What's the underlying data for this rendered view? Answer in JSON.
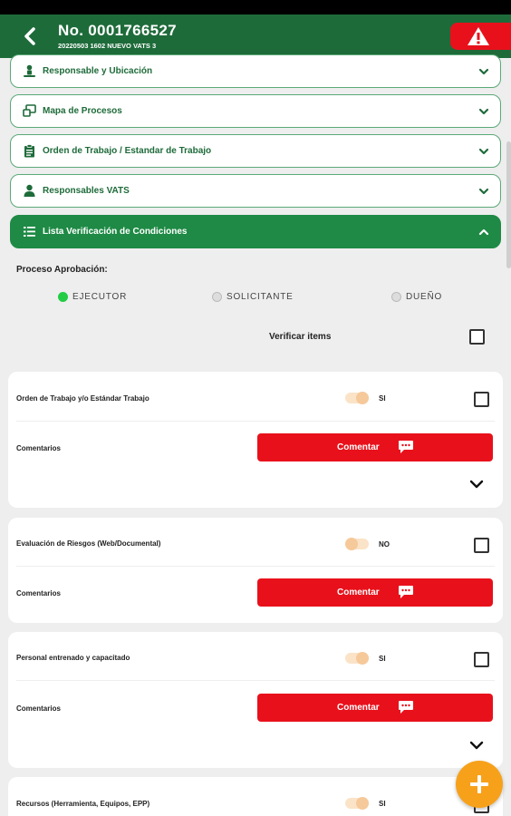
{
  "header": {
    "title": "No. 0001766527",
    "subtitle": "20220503 1602 NUEVO VATS 3"
  },
  "accordions": [
    {
      "label": "Responsable y Ubicación",
      "icon": "person-location-icon",
      "expanded": false
    },
    {
      "label": "Mapa de Procesos",
      "icon": "map-icon",
      "expanded": false
    },
    {
      "label": "Orden de Trabajo / Estandar de Trabajo",
      "icon": "clipboard-icon",
      "expanded": false
    },
    {
      "label": "Responsables VATS",
      "icon": "person-badge-icon",
      "expanded": false
    },
    {
      "label": "Lista Verificación de Condiciones",
      "icon": "checklist-icon",
      "expanded": true
    }
  ],
  "approval": {
    "label": "Proceso Aprobación:",
    "options": [
      {
        "label": "EJECUTOR",
        "selected": true
      },
      {
        "label": "SOLICITANTE",
        "selected": false
      },
      {
        "label": "DUEÑO",
        "selected": false
      }
    ]
  },
  "verify": {
    "label": "Verificar items",
    "checked": false
  },
  "items": [
    {
      "label": "Orden de Trabajo y/o Estándar Trabajo",
      "toggle_label": "SI",
      "toggle_on": true,
      "checked": false,
      "comment_label": "Comentarios",
      "button_label": "Comentar"
    },
    {
      "label": "Evaluación de Riesgos (Web/Documental)",
      "toggle_label": "NO",
      "toggle_on": false,
      "checked": false,
      "comment_label": "Comentarios",
      "button_label": "Comentar"
    },
    {
      "label": "Personal entrenado y capacitado",
      "toggle_label": "SI",
      "toggle_on": true,
      "checked": false,
      "comment_label": "Comentarios",
      "button_label": "Comentar"
    },
    {
      "label": "Recursos (Herramienta, Equipos, EPP)",
      "toggle_label": "SI",
      "toggle_on": true,
      "checked": false
    }
  ],
  "colors": {
    "primary_green": "#1e6b3a",
    "active_green": "#1e8a45",
    "alert_red": "#e8111b",
    "fab_orange": "#f7a11a"
  }
}
